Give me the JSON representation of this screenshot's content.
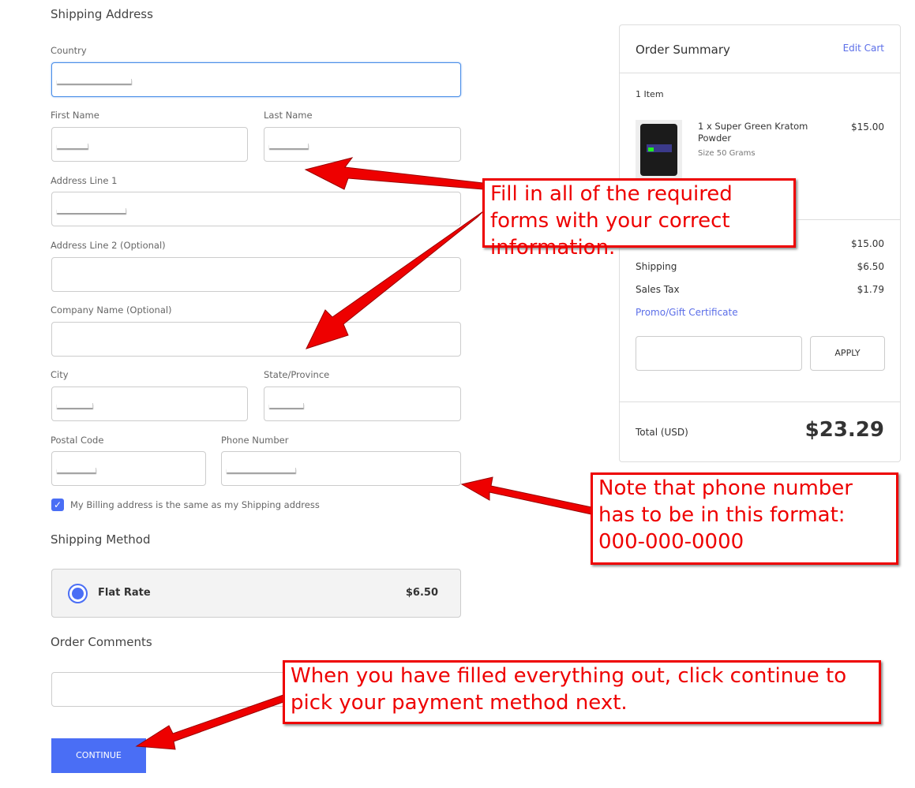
{
  "form": {
    "shipping_title": "Shipping Address",
    "country_label": "Country",
    "first_name_label": "First Name",
    "last_name_label": "Last Name",
    "address1_label": "Address Line 1",
    "address2_label": "Address Line 2 (Optional)",
    "company_label": "Company Name (Optional)",
    "city_label": "City",
    "state_label": "State/Province",
    "postal_label": "Postal Code",
    "phone_label": "Phone Number",
    "billing_same_label": "My Billing address is the same as my Shipping address",
    "billing_same_checked": true,
    "shipping_method_title": "Shipping Method",
    "shipping_option": {
      "name": "Flat Rate",
      "price": "$6.50",
      "selected": true
    },
    "comments_title": "Order Comments",
    "continue_label": "CONTINUE"
  },
  "summary": {
    "title": "Order Summary",
    "edit_cart": "Edit Cart",
    "item_count": "1 Item",
    "item": {
      "name": "1 x Super Green Kratom Powder",
      "variant": "Size 50 Grams",
      "price": "$15.00"
    },
    "subtotal": "$15.00",
    "shipping_label": "Shipping",
    "shipping": "$6.50",
    "tax_label": "Sales Tax",
    "tax": "$1.79",
    "promo_label": "Promo/Gift Certificate",
    "apply_label": "APPLY",
    "total_label": "Total (USD)",
    "total": "$23.29"
  },
  "annotations": {
    "fill_note": "Fill in all of the required forms with your correct information.",
    "phone_note": "Note that phone number has to be in this format: 000-000-0000",
    "continue_note": "When you have filled everything out, click continue to pick your payment method next.",
    "color": "#ee0000"
  },
  "colors": {
    "accent": "#4a6ef5",
    "annotation": "#ee0000"
  }
}
